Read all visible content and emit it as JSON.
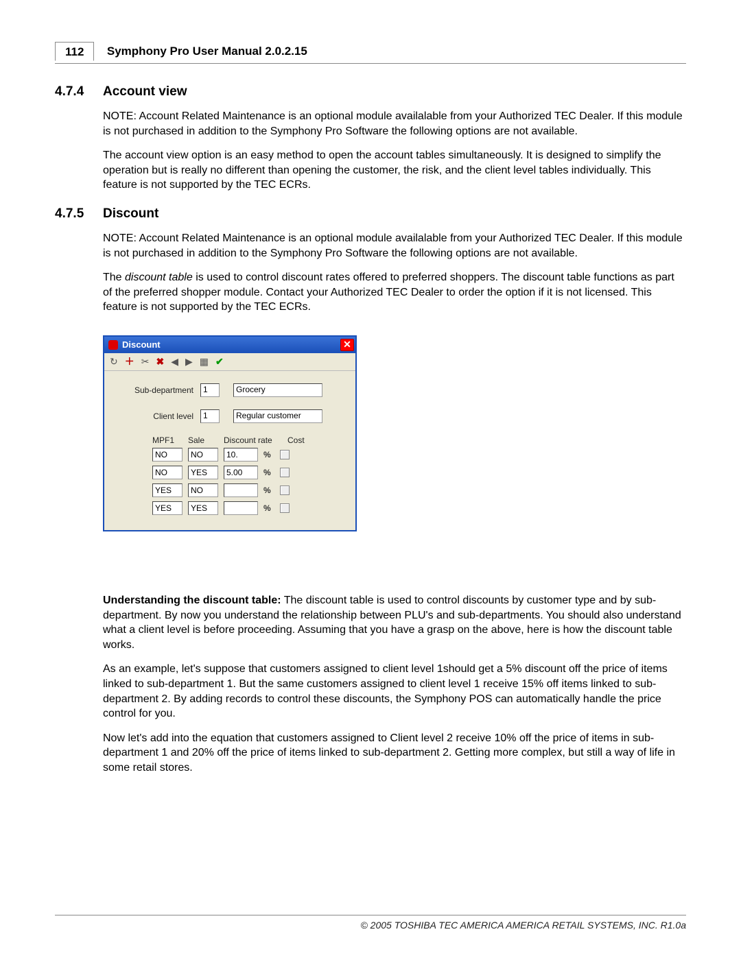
{
  "header": {
    "page_no": "112",
    "title": "Symphony Pro User Manual  2.0.2.15"
  },
  "sec_474": {
    "num": "4.7.4",
    "title": "Account view",
    "note": "NOTE: Account Related Maintenance is an optional module availalable from your Authorized TEC Dealer. If this module is not purchased in addition to the Symphony Pro Software the following options are not available.",
    "p1": "The account view option is an easy method to open the account tables simultaneously. It is designed to simplify the operation but is really no different than opening the customer, the risk, and the client level tables individually. This feature is not supported by the TEC ECRs."
  },
  "sec_475": {
    "num": "4.7.5",
    "title": "Discount",
    "note": "NOTE: Account Related Maintenance is an optional module availalable from your Authorized TEC Dealer. If this module is not purchased in addition to the Symphony Pro Software the following options are not available.",
    "p1_a": "The ",
    "p1_i": "discount table",
    "p1_b": " is used to control discount rates offered to preferred shoppers. The discount table functions as part of the preferred shopper module. Contact your Authorized TEC Dealer to order the option if it is not licensed. This feature is not supported by the TEC ECRs."
  },
  "dialog": {
    "title": "Discount",
    "subdept_label": "Sub-department",
    "subdept_code": "1",
    "subdept_name": "Grocery",
    "client_label": "Client level",
    "client_code": "1",
    "client_name": "Regular customer",
    "hdr_mpf": "MPF1",
    "hdr_sale": "Sale",
    "hdr_rate": "Discount rate",
    "hdr_cost": "Cost",
    "rows": {
      "r0": {
        "mpf": "NO",
        "sale": "NO",
        "rate": "10."
      },
      "r1": {
        "mpf": "NO",
        "sale": "YES",
        "rate": "5.00"
      },
      "r2": {
        "mpf": "YES",
        "sale": "NO",
        "rate": ""
      },
      "r3": {
        "mpf": "YES",
        "sale": "YES",
        "rate": ""
      }
    },
    "pct": "%"
  },
  "under": {
    "lead": "Understanding the discount table:",
    "p1": "  The discount table is used to control discounts by customer type and by sub-department. By now you understand the relationship between PLU's and sub-departments. You should also understand what a client level is before proceeding. Assuming that you have a grasp on the above, here is how the discount table works.",
    "p2": " As an example, let's suppose that customers assigned to client level 1should get a 5% discount off the price of items linked to sub-department 1. But the same customers assigned to client level 1 receive 15% off items linked to sub-department 2. By adding records to control these discounts, the Symphony POS can automatically handle the price control for you.",
    "p3": " Now let's add into the equation that customers assigned to Client level 2 receive 10% off the price of items in sub-department 1 and 20% off the price of items linked to sub-department 2. Getting more complex, but still a way of life in some retail stores."
  },
  "footer": "© 2005 TOSHIBA TEC AMERICA AMERICA RETAIL SYSTEMS, INC.   R1.0a"
}
